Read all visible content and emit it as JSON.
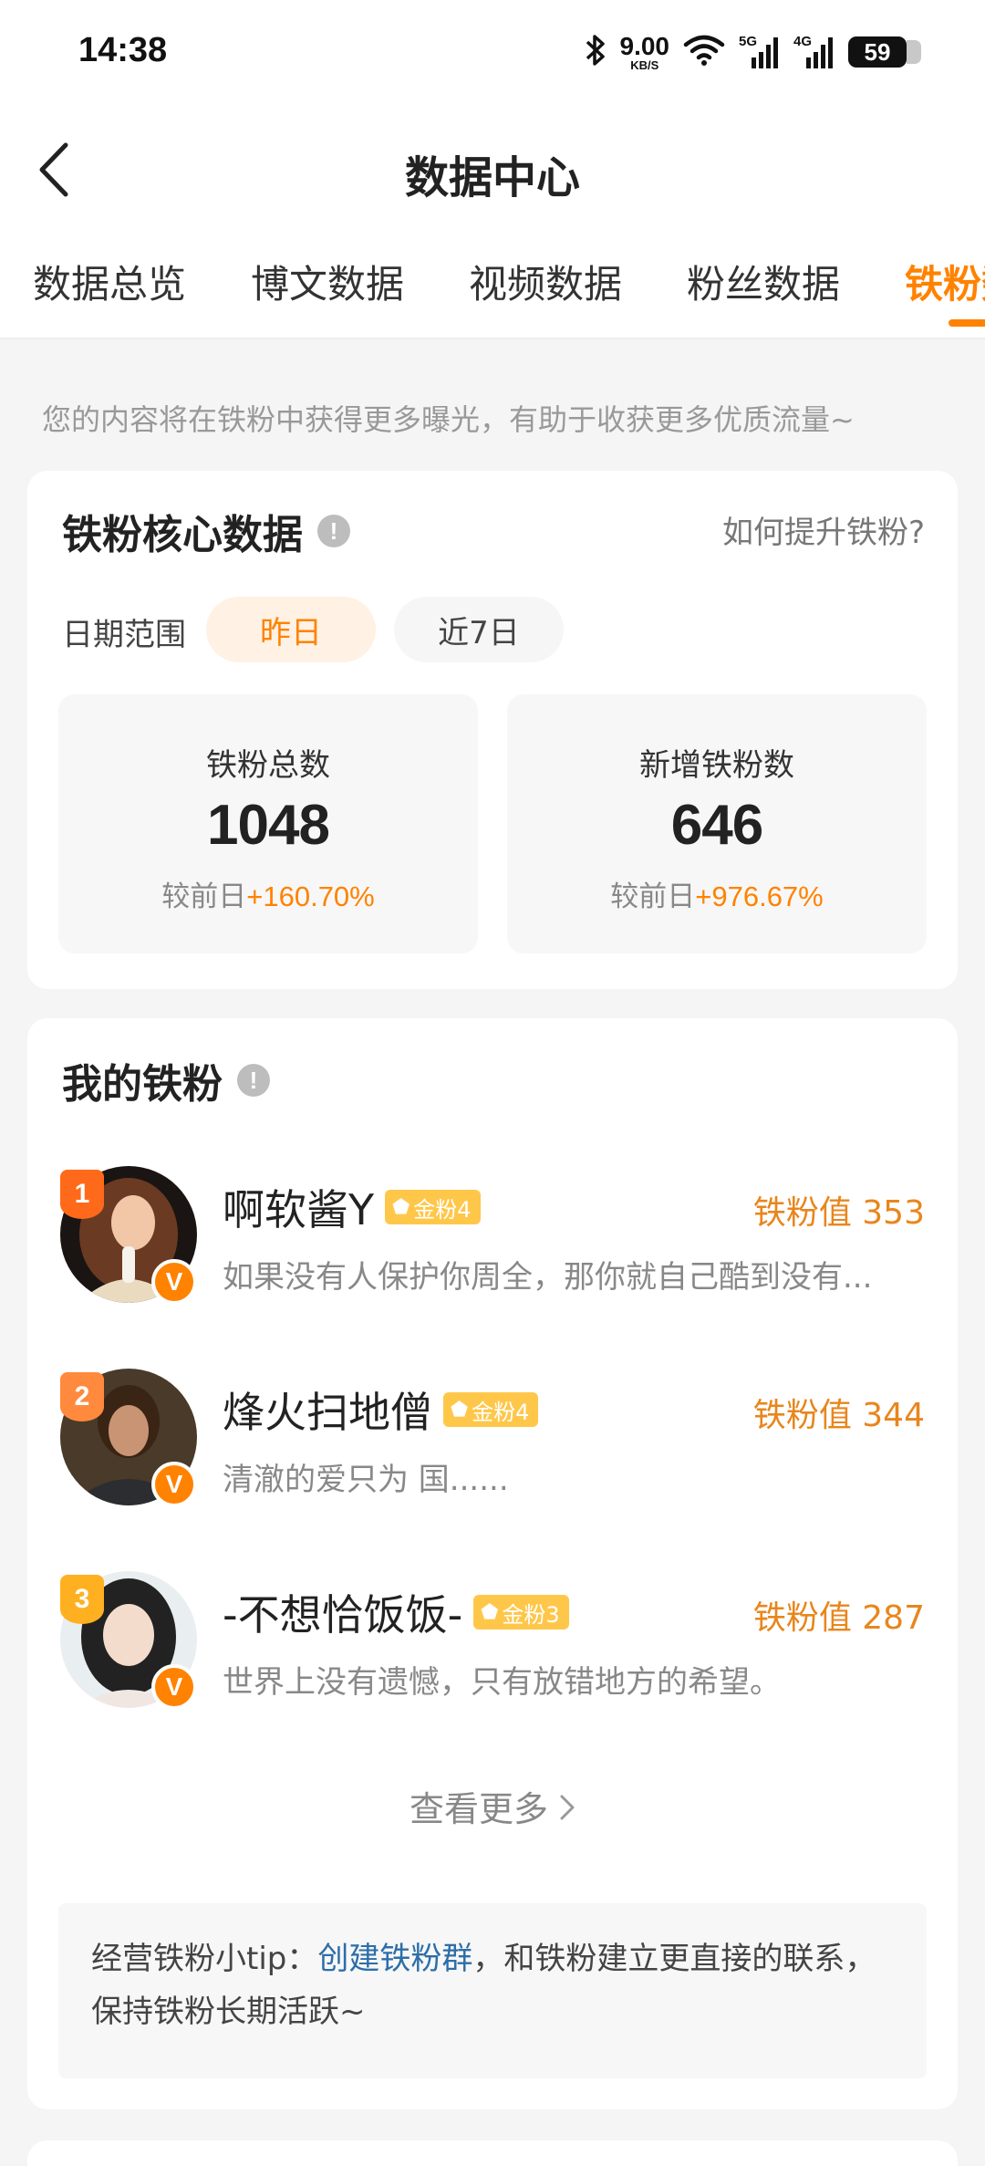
{
  "status_bar": {
    "time": "14:38",
    "net_speed": "9.00",
    "net_unit": "KB/S",
    "sig1": "5G",
    "sig2": "4G",
    "battery": "59"
  },
  "nav": {
    "title": "数据中心"
  },
  "tabs": [
    {
      "label": "数据总览",
      "active": false
    },
    {
      "label": "博文数据",
      "active": false
    },
    {
      "label": "视频数据",
      "active": false
    },
    {
      "label": "粉丝数据",
      "active": false
    },
    {
      "label": "铁粉数据",
      "active": true
    }
  ],
  "notice": "您的内容将在铁粉中获得更多曝光，有助于收获更多优质流量~",
  "core": {
    "title": "铁粉核心数据",
    "help": "如何提升铁粉?",
    "date_label": "日期范围",
    "chips": [
      "昨日",
      "近7日"
    ],
    "stats": [
      {
        "label": "铁粉总数",
        "value": "1048",
        "cmp_label": "较前日",
        "cmp_value": "+160.70%"
      },
      {
        "label": "新增铁粉数",
        "value": "646",
        "cmp_label": "较前日",
        "cmp_value": "+976.67%"
      }
    ]
  },
  "my_fans": {
    "title": "我的铁粉",
    "fans": [
      {
        "rank": "1",
        "name": "啊软酱Y",
        "level": "金粉4",
        "value": "铁粉值 353",
        "bio": "如果没有人保护你周全，那你就自己酷到没有..."
      },
      {
        "rank": "2",
        "name": "烽火扫地僧",
        "level": "金粉4",
        "value": "铁粉值 344",
        "bio": "清澈的爱只为 国......"
      },
      {
        "rank": "3",
        "name": "-不想恰饭饭-",
        "level": "金粉3",
        "value": "铁粉值 287",
        "bio": "世界上没有遗憾，只有放错地方的希望。"
      }
    ],
    "more": "查看更多",
    "tip_prefix": "经营铁粉小tip：",
    "tip_link": "创建铁粉群",
    "tip_suffix": "，和铁粉建立更直接的联系，保持铁粉长期活跃~"
  },
  "colors": {
    "accent": "#ff8200",
    "link": "#2d6ea8"
  }
}
